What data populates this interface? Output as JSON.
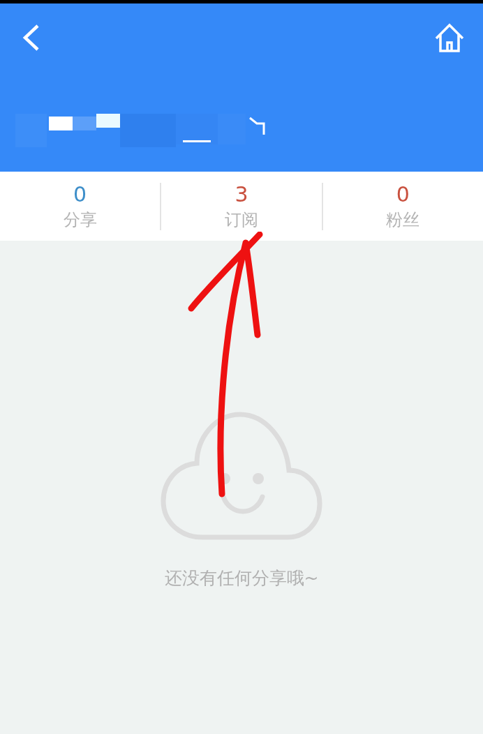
{
  "header": {
    "redacted_name": true
  },
  "stats": [
    {
      "count": "0",
      "label": "分享",
      "color": "#3d8ec9"
    },
    {
      "count": "3",
      "label": "订阅",
      "color": "#c9513f"
    },
    {
      "count": "0",
      "label": "粉丝",
      "color": "#c9513f"
    }
  ],
  "empty_state": {
    "message": "还没有任何分享哦~"
  }
}
